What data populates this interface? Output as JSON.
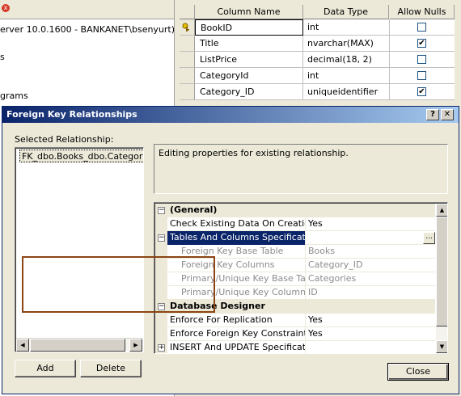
{
  "explorer": {
    "close_glyph": "x",
    "server_text": "erver 10.0.1600 - BANKANET\\bsenyurt)",
    "fragment_1": "s",
    "fragment_2": "grams"
  },
  "designer": {
    "columns": [
      "Column Name",
      "Data Type",
      "Allow Nulls"
    ],
    "rows": [
      {
        "name": "BookID",
        "type": "int",
        "allow_nulls": false,
        "primary_key": true
      },
      {
        "name": "Title",
        "type": "nvarchar(MAX)",
        "allow_nulls": true
      },
      {
        "name": "ListPrice",
        "type": "decimal(18, 2)",
        "allow_nulls": false
      },
      {
        "name": "CategoryId",
        "type": "int",
        "allow_nulls": false
      },
      {
        "name": "Category_ID",
        "type": "uniqueidentifier",
        "allow_nulls": true
      }
    ],
    "check_mark": "✔"
  },
  "dialog": {
    "title": "Foreign Key Relationships",
    "help_glyph": "?",
    "close_glyph": "✕",
    "selected_label": "Selected Relationship:",
    "relationships": [
      "FK_dbo.Books_dbo.Categories"
    ],
    "description": "Editing properties for existing relationship.",
    "add_label": "Add",
    "delete_label": "Delete",
    "close_label": "Close",
    "ellipsis": "...",
    "properties": {
      "general": {
        "category": "(General)",
        "check_existing_name": "Check Existing Data On Creation O",
        "check_existing_value": "Yes",
        "tables_columns_name": "Tables And Columns Specification",
        "fk_base_table_name": "Foreign Key Base Table",
        "fk_base_table_value": "Books",
        "fk_columns_name": "Foreign Key Columns",
        "fk_columns_value": "Category_ID",
        "pk_base_table_name": "Primary/Unique Key Base Table",
        "pk_base_table_value": "Categories",
        "pk_columns_name": "Primary/Unique Key Columns",
        "pk_columns_value": "ID"
      },
      "designer": {
        "category": "Database Designer",
        "replication_name": "Enforce For Replication",
        "replication_value": "Yes",
        "fk_constraint_name": "Enforce Foreign Key Constraint",
        "fk_constraint_value": "Yes",
        "insert_update_name": "INSERT And UPDATE Specification"
      }
    },
    "expanded_glyph": "−",
    "collapsed_glyph": "+"
  },
  "colors": {
    "titlebar": "#0a246a",
    "highlight": "#0a246a",
    "annotation_frame": "#8b4513"
  }
}
